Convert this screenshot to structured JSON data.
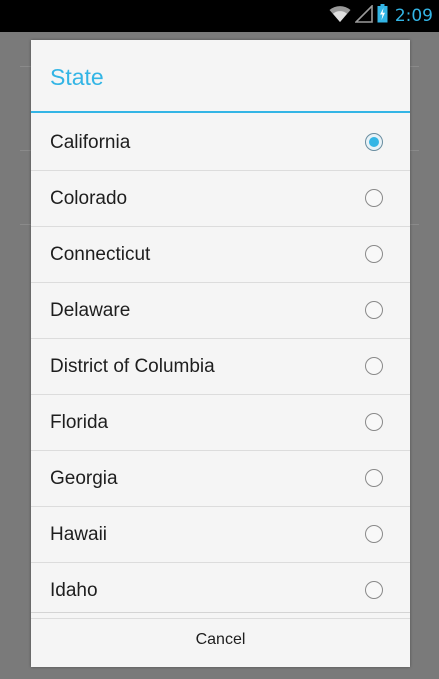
{
  "status_bar": {
    "time": "2:09",
    "wifi_icon": "wifi-icon",
    "signal_icon": "signal-icon",
    "battery_icon": "battery-charging-icon"
  },
  "dialog": {
    "title": "State",
    "options": [
      {
        "label": "California",
        "checked": true
      },
      {
        "label": "Colorado",
        "checked": false
      },
      {
        "label": "Connecticut",
        "checked": false
      },
      {
        "label": "Delaware",
        "checked": false
      },
      {
        "label": "District of Columbia",
        "checked": false
      },
      {
        "label": "Florida",
        "checked": false
      },
      {
        "label": "Georgia",
        "checked": false
      },
      {
        "label": "Hawaii",
        "checked": false
      },
      {
        "label": "Idaho",
        "checked": false
      }
    ],
    "cancel_label": "Cancel"
  },
  "colors": {
    "accent": "#33b5e5",
    "status_bar": "#000000",
    "dialog_background": "#f5f5f5",
    "dim_background": "#7a7a7a"
  }
}
